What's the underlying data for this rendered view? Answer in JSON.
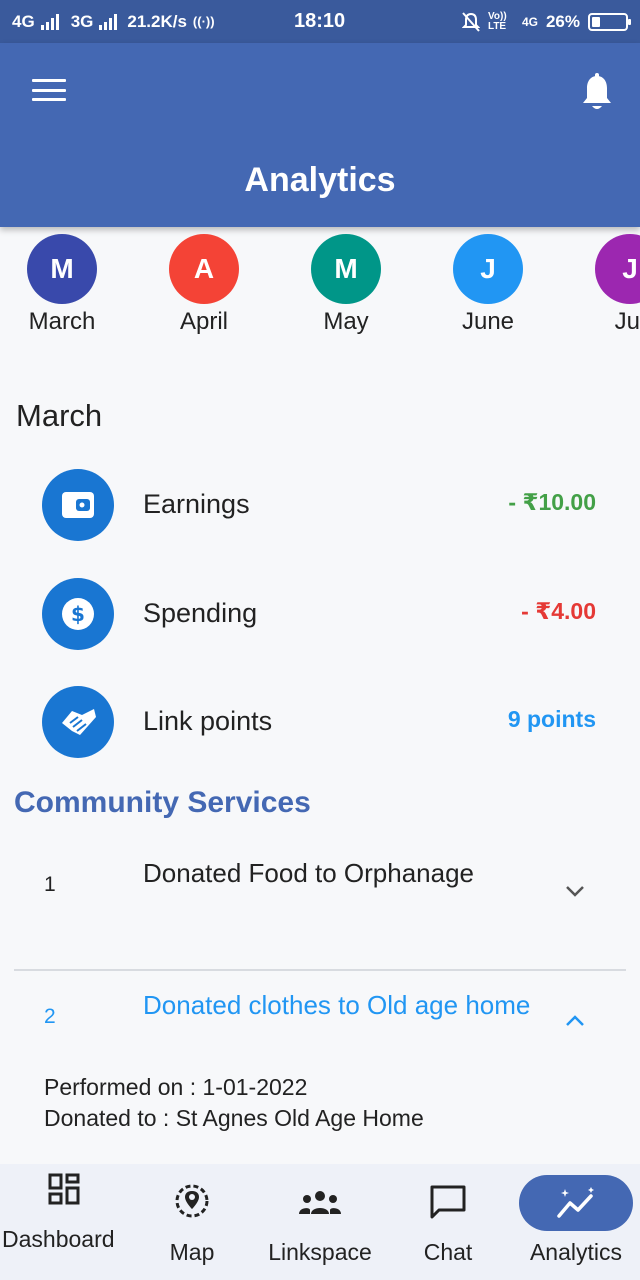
{
  "status_bar": {
    "net1": "4G",
    "net2": "3G",
    "speed": "21.2K/s",
    "time": "18:10",
    "volte": "Vo)) LTE",
    "net3": "4G",
    "battery": "26%",
    "battery_level": 0.26
  },
  "app_bar": {
    "title": "Analytics"
  },
  "months": [
    {
      "initial": "M",
      "label": "March",
      "color": "#3949ab"
    },
    {
      "initial": "A",
      "label": "April",
      "color": "#f44336"
    },
    {
      "initial": "M",
      "label": "May",
      "color": "#009688"
    },
    {
      "initial": "J",
      "label": "June",
      "color": "#2196f3"
    },
    {
      "initial": "J",
      "label": "Jul",
      "color": "#9c27b0"
    }
  ],
  "selected_month": "March",
  "stats": {
    "earnings": {
      "label": "Earnings",
      "value": "- ₹10.00",
      "color": "#43a047"
    },
    "spending": {
      "label": "Spending",
      "value": "- ₹4.00",
      "color": "#e53935"
    },
    "link_points": {
      "label": "Link points",
      "value": "9 points",
      "color": "#2196f3"
    }
  },
  "community": {
    "title": "Community Services",
    "items": [
      {
        "num": "1",
        "text": "Donated Food to Orphanage"
      },
      {
        "num": "2",
        "text": "Donated clothes to Old age home",
        "performed_on": "Performed on : 1-01-2022",
        "donated_to": "Donated to : St Agnes Old Age Home"
      }
    ]
  },
  "bottom_nav": {
    "dashboard": "Dashboard",
    "map": "Map",
    "linkspace": "Linkspace",
    "chat": "Chat",
    "analytics": "Analytics"
  },
  "colors": {
    "primary": "#4468b3",
    "status_bar": "#3a5a9c",
    "accent": "#2196f3"
  }
}
